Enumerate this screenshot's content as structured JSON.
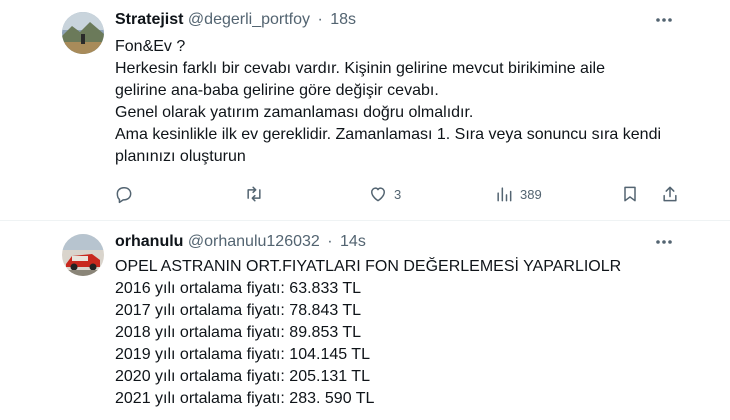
{
  "tweets": [
    {
      "name": "Stratejist",
      "handle": "@degerli_portfoy",
      "separator": "·",
      "time": "18s",
      "lines": [
        "Fon&Ev ?",
        "Herkesin farklı bir cevabı vardır. Kişinin gelirine mevcut birikimine aile",
        "gelirine ana-baba gelirine göre değişir cevabı.",
        "Genel olarak yatırım zamanlaması doğru olmalıdır.",
        "Ama kesinlikle ilk ev gereklidir. Zamanlaması 1. Sıra veya sonuncu sıra kendi",
        "planınızı oluşturun"
      ],
      "actions": {
        "reply_icon": "reply-icon",
        "retweet_icon": "retweet-icon",
        "like_icon": "heart-icon",
        "like_count": "3",
        "views_icon": "views-chart-icon",
        "views_count": "389",
        "bookmark_icon": "bookmark-icon",
        "share_icon": "share-icon"
      }
    },
    {
      "name": "orhanulu",
      "handle": "@orhanulu126032",
      "separator": "·",
      "time": "14s",
      "lines": [
        "OPEL ASTRANIN ORT.FIYATLARI FON DEĞERLEMESİ YAPARLIOLR",
        "2016 yılı ortalama fiyatı: 63.833 TL",
        "2017 yılı ortalama fiyatı: 78.843 TL",
        "2018 yılı ortalama fiyatı: 89.853 TL",
        "2019 yılı ortalama fiyatı: 104.145 TL",
        "2020 yılı ortalama fiyatı: 205.131 TL",
        "2021 yılı ortalama fiyatı: 283. 590 TL"
      ]
    }
  ],
  "colors": {
    "text_primary": "#0f1419",
    "text_secondary": "#536471",
    "divider": "#eff3f4"
  }
}
